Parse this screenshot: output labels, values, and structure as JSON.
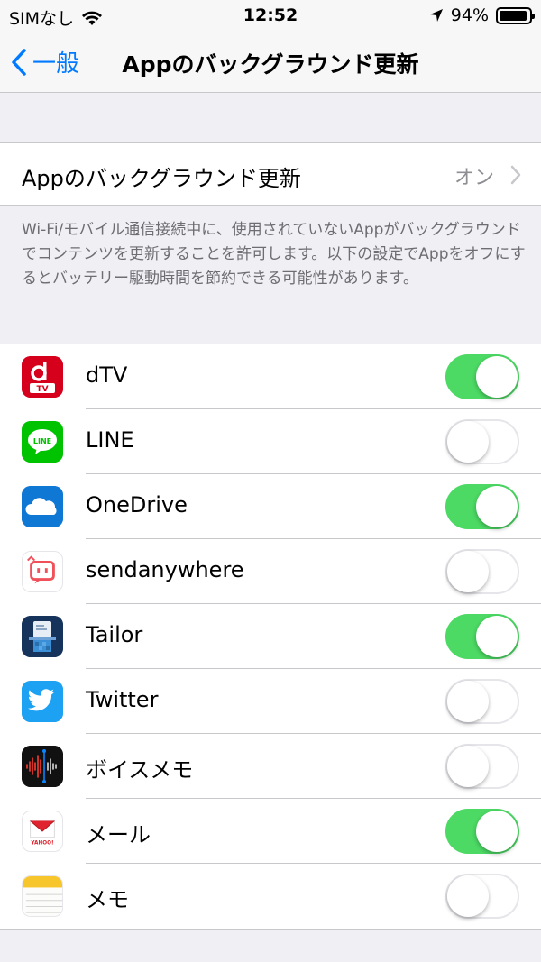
{
  "status_bar": {
    "carrier": "SIMなし",
    "time": "12:52",
    "battery_percent": "94%"
  },
  "nav": {
    "back_label": "一般",
    "title": "Appのバックグラウンド更新"
  },
  "main_setting": {
    "label": "Appのバックグラウンド更新",
    "value": "オン"
  },
  "footer_text": "Wi-Fi/モバイル通信接続中に、使用されていないAppがバックグラウンドでコンテンツを更新することを許可します。以下の設定でAppをオフにするとバッテリー駆動時間を節約できる可能性があります。",
  "colors": {
    "accent": "#007aff",
    "toggle_on": "#4cd964"
  },
  "apps": [
    {
      "name": "dTV",
      "icon": "dtv-icon",
      "enabled": true
    },
    {
      "name": "LINE",
      "icon": "line-icon",
      "enabled": false
    },
    {
      "name": "OneDrive",
      "icon": "onedrive-icon",
      "enabled": true
    },
    {
      "name": "sendanywhere",
      "icon": "sendanywhere-icon",
      "enabled": false
    },
    {
      "name": "Tailor",
      "icon": "tailor-icon",
      "enabled": true
    },
    {
      "name": "Twitter",
      "icon": "twitter-icon",
      "enabled": false
    },
    {
      "name": "ボイスメモ",
      "icon": "voice-memo-icon",
      "enabled": false
    },
    {
      "name": "メール",
      "icon": "yahoo-mail-icon",
      "enabled": true
    },
    {
      "name": "メモ",
      "icon": "notes-icon",
      "enabled": false
    }
  ],
  "icon_text": {
    "dtv": "TV",
    "line": "LINE",
    "yahoo": "YAHOO!"
  }
}
